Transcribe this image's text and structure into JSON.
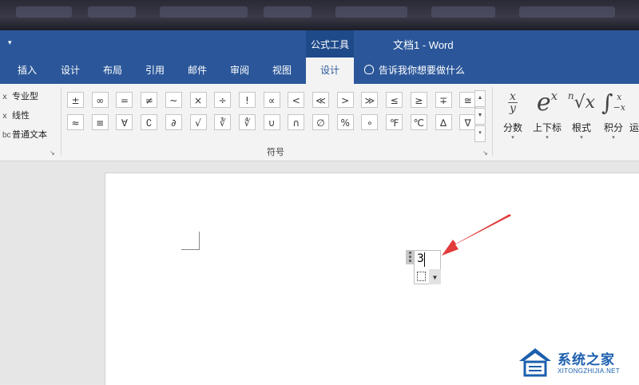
{
  "titlebar": {
    "qat_dropdown": "▾",
    "context_group": "公式工具",
    "doc_title": "文档1  -  Word"
  },
  "tabs": [
    {
      "label": "插入"
    },
    {
      "label": "设计"
    },
    {
      "label": "布局"
    },
    {
      "label": "引用"
    },
    {
      "label": "邮件"
    },
    {
      "label": "审阅"
    },
    {
      "label": "视图"
    },
    {
      "label": "设计",
      "active": true
    }
  ],
  "tellme": "告诉我你想要做什么",
  "tools": {
    "options": [
      {
        "icon": "ⅹ",
        "label": "专业型"
      },
      {
        "icon": "ⅹ",
        "label": "线性"
      },
      {
        "icon": "bc",
        "label": "普通文本"
      }
    ],
    "launcher": "↘"
  },
  "symbols": {
    "row1": [
      "±",
      "∞",
      "=",
      "≠",
      "~",
      "×",
      "÷",
      "!",
      "∝",
      "<",
      "≪",
      ">",
      "≫",
      "≤",
      "≥",
      "∓",
      "≅"
    ],
    "row2": [
      "≈",
      "≡",
      "∀",
      "∁",
      "∂",
      "√",
      "∛",
      "∜",
      "∪",
      "∩",
      "∅",
      "%",
      "∘",
      "℉",
      "℃",
      "∆",
      "∇"
    ],
    "scroll": [
      "▲",
      "▼",
      "▾"
    ],
    "group_label": "符号",
    "launcher": "↘"
  },
  "structures": [
    {
      "label": "分数",
      "icon": "fraction-icon"
    },
    {
      "label": "上下标",
      "icon": "script-icon",
      "glyph": "e",
      "sup": "x"
    },
    {
      "label": "根式",
      "icon": "radical-icon",
      "glyph": "√x",
      "idx": "n"
    },
    {
      "label": "积分",
      "icon": "integral-icon",
      "glyph": "∫",
      "up": "x",
      "lo": "−x"
    },
    {
      "label": "运",
      "icon": "operator-icon"
    }
  ],
  "fraction_glyph": {
    "num": "x",
    "den": "y"
  },
  "equation": {
    "value": "3"
  },
  "watermark": {
    "name": "系统之家",
    "url": "XITONGZHIJIA.NET"
  },
  "colors": {
    "ribbon_blue": "#2b579a",
    "arrow_red": "#e23b3b",
    "watermark_blue": "#1c5fae"
  }
}
